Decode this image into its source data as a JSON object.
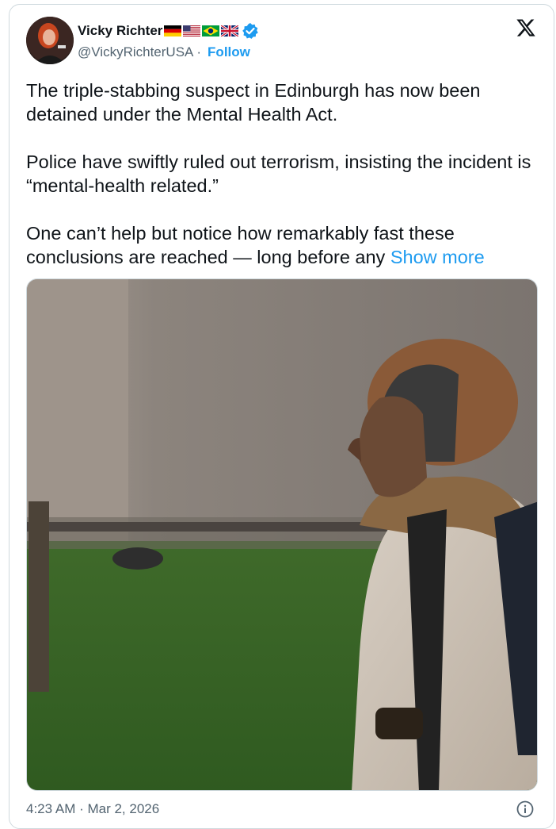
{
  "author": {
    "display_name": "Vicky Richter",
    "flags": [
      "germany-flag-icon",
      "usa-flag-icon",
      "brazil-flag-icon",
      "uk-flag-icon"
    ],
    "verified_icon": "verified-badge-icon",
    "handle": "@VickyRichterUSA",
    "separator": "·",
    "follow_label": "Follow",
    "avatar_icon": "avatar"
  },
  "platform_icon": "x-logo-icon",
  "post": {
    "paragraph_1": "The triple-stabbing suspect in Edinburgh has now been detained under the Mental Health Act.",
    "paragraph_2": "Police have swiftly ruled out terrorism, insisting the incident is “mental-health related.”",
    "paragraph_3": "One can’t help but notice how remarkably fast these conclusions are reached — long before any ",
    "show_more_label": "Show more"
  },
  "media": {
    "type": "photo"
  },
  "footer": {
    "timestamp": "4:23 AM · Mar 2, 2026",
    "info_icon": "info-icon"
  },
  "colors": {
    "accent": "#1d9bf0",
    "text": "#0f1419",
    "secondary": "#536471",
    "border": "#cfd9de"
  }
}
